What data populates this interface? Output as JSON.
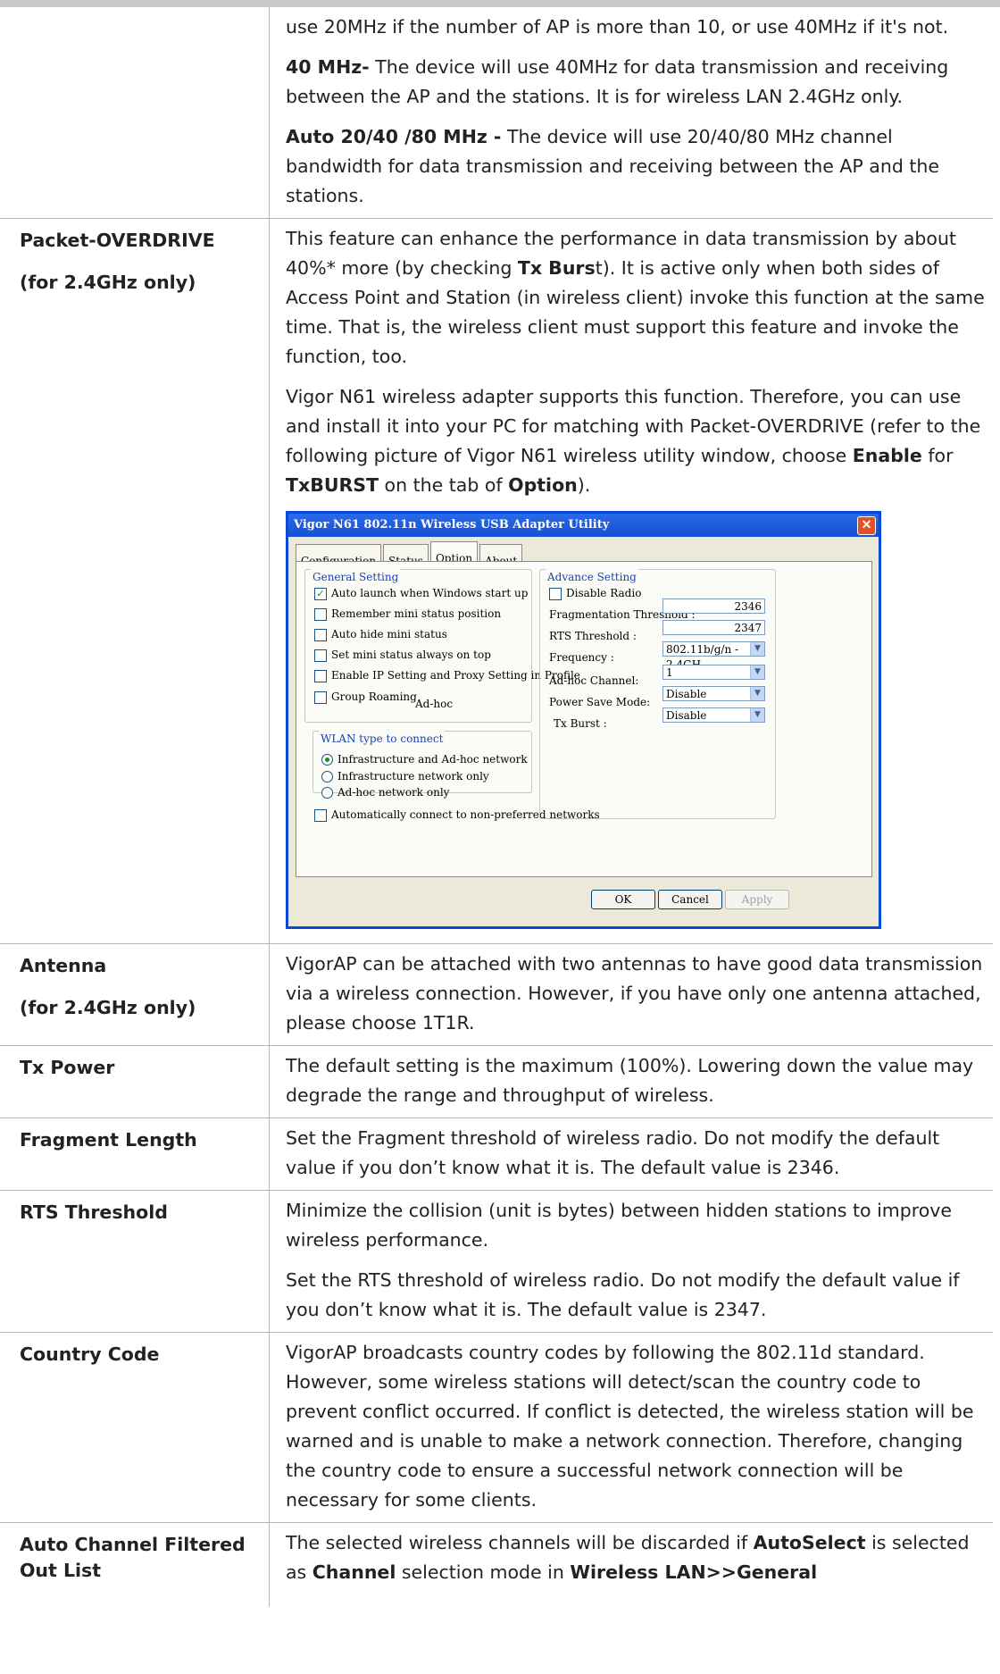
{
  "rows": [
    {
      "label": [],
      "paras": [
        [
          {
            "t": "use 20MHz if the number of AP is more than 10, or use 40MHz if it's not."
          }
        ],
        [
          {
            "t": "40 MHz-",
            "b": true
          },
          {
            "t": " The device will use 40MHz for data transmission and receiving between the AP and the stations. It is for wireless LAN 2.4GHz only."
          }
        ],
        [
          {
            "t": "Auto 20/40 /80 MHz -",
            "b": true
          },
          {
            "t": " The device will use 20/40/80 MHz channel bandwidth for data transmission and receiving between the AP and the stations."
          }
        ]
      ]
    },
    {
      "label": [
        "Packet-OVERDRIVE",
        "(for 2.4GHz only)"
      ],
      "paras": [
        [
          {
            "t": "This feature can enhance the performance in data transmission by about 40%* more (by checking "
          },
          {
            "t": "Tx Burs",
            "b": true
          },
          {
            "t": "t). It is active only when both sides of Access Point and Station (in wireless client) invoke this function at the same time. That is, the wireless client must support this feature and invoke the function, too."
          }
        ],
        [
          {
            "t": "Vigor N61 wireless adapter supports this function. Therefore, you can use and install it into your PC for matching with Packet-OVERDRIVE (refer to the following picture of Vigor N61 wireless utility window, choose "
          },
          {
            "t": "Enable",
            "b": true
          },
          {
            "t": " for "
          },
          {
            "t": "TxBURST",
            "b": true
          },
          {
            "t": " on the tab of "
          },
          {
            "t": "Option",
            "b": true
          },
          {
            "t": ")."
          }
        ]
      ],
      "screenshot": true
    },
    {
      "label": [
        "Antenna",
        "(for 2.4GHz only)"
      ],
      "paras": [
        [
          {
            "t": "VigorAP can be attached with two antennas to have good data transmission via a wireless connection. However, if you have only one antenna attached, please choose 1T1R."
          }
        ]
      ]
    },
    {
      "label": [
        "Tx Power"
      ],
      "paras": [
        [
          {
            "t": "The default setting is the maximum (100%). Lowering down the value may degrade the range and throughput of wireless."
          }
        ]
      ]
    },
    {
      "label": [
        "Fragment Length"
      ],
      "paras": [
        [
          {
            "t": "Set the Fragment threshold of wireless radio. Do not modify the default value if you don’t know what it is. The default value is 2346."
          }
        ]
      ]
    },
    {
      "label": [
        "RTS Threshold"
      ],
      "paras": [
        [
          {
            "t": "Minimize the collision (unit is bytes) between hidden stations to improve wireless performance."
          }
        ],
        [
          {
            "t": "Set the RTS threshold of wireless radio. Do not modify the default value if you don’t know what it is. The default value is 2347."
          }
        ]
      ]
    },
    {
      "label": [
        "Country Code"
      ],
      "paras": [
        [
          {
            "t": "VigorAP broadcasts country codes by following the 802.11d standard. However, some wireless stations will detect/scan the country code to prevent conflict occurred. If conflict is detected, the wireless station will be warned and is unable to make a network connection. Therefore, changing the country code to ensure a successful network connection will be necessary for some clients."
          }
        ]
      ]
    },
    {
      "label": [
        "Auto Channel Filtered Out List"
      ],
      "paras": [
        [
          {
            "t": "The selected wireless channels will be discarded if "
          },
          {
            "t": "AutoSelect",
            "b": true
          },
          {
            "t": " is selected as "
          },
          {
            "t": "Channel",
            "b": true
          },
          {
            "t": " selection mode in "
          },
          {
            "t": "Wireless LAN>>General",
            "b": true
          }
        ]
      ]
    }
  ],
  "dialog": {
    "title": "Vigor N61 802.11n Wireless USB Adapter Utility",
    "close_glyph": "✕",
    "tabs": [
      "Configuration",
      "Status",
      "Option",
      "About"
    ],
    "active_tab": "Option",
    "general_legend": "General Setting",
    "general_items": [
      {
        "label": "Auto launch when Windows start up",
        "checked": true
      },
      {
        "label": "Remember mini status position",
        "checked": false
      },
      {
        "label": "Auto hide mini status",
        "checked": false
      },
      {
        "label": "Set mini status always on top",
        "checked": false
      },
      {
        "label": "Enable IP Setting and Proxy Setting in Profile",
        "checked": false
      },
      {
        "label": "Group Roaming",
        "checked": false
      }
    ],
    "adhoc_text": "Ad-hoc",
    "wlan_legend": "WLAN type to connect",
    "wlan_items": [
      {
        "label": "Infrastructure and Ad-hoc network",
        "selected": true
      },
      {
        "label": "Infrastructure network only",
        "selected": false
      },
      {
        "label": "Ad-hoc network only",
        "selected": false
      }
    ],
    "auto_connect": "Automatically connect to non-preferred networks",
    "advance_legend": "Advance Setting",
    "disable_radio": "Disable Radio",
    "frag_label": "Fragmentation Threshold :",
    "frag_value": "2346",
    "rts_label": "RTS Threshold :",
    "rts_value": "2347",
    "freq_label": "Frequency :",
    "freq_value": "802.11b/g/n - 2.4GH",
    "channel_label": "Ad-hoc Channel:",
    "channel_value": "1",
    "power_label": "Power Save Mode:",
    "power_value": "Disable",
    "burst_label": "Tx Burst :",
    "burst_value": "Disable",
    "ok": "OK",
    "cancel": "Cancel",
    "apply": "Apply",
    "arrow_glyph": "▼"
  }
}
